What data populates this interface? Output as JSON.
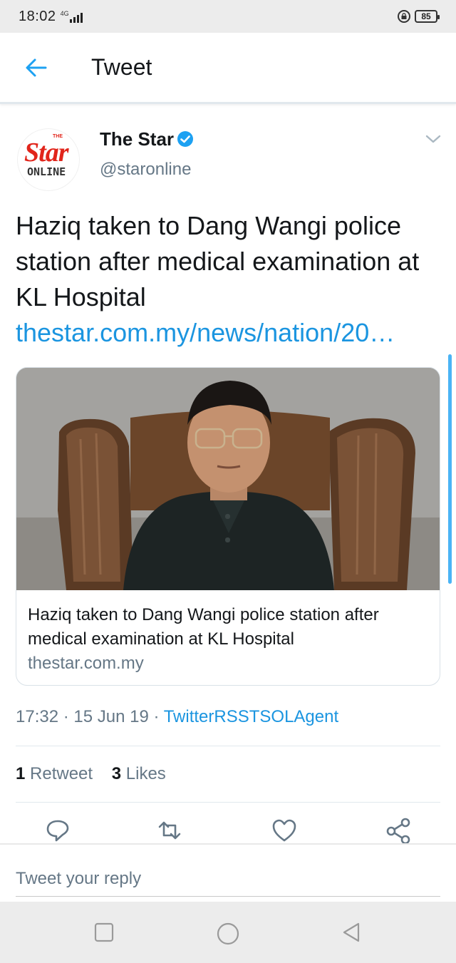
{
  "status_bar": {
    "time": "18:02",
    "network": "4G",
    "battery": "85"
  },
  "header": {
    "title": "Tweet"
  },
  "author": {
    "name": "The Star",
    "handle": "@staronline",
    "avatar_logo_top": "THE",
    "avatar_logo_main": "Star",
    "avatar_logo_sub": "ONLINE"
  },
  "tweet": {
    "text": "Haziq taken to Dang Wangi police station after medical examination at KL Hospital",
    "link": "thestar.com.my/news/nation/20…"
  },
  "card": {
    "title": "Haziq taken to Dang Wangi police station after medical examination at KL Hospital",
    "domain": "thestar.com.my"
  },
  "meta": {
    "time": "17:32",
    "date": "15 Jun 19",
    "separator": " · ",
    "source": "TwitterRSSTSOLAgent"
  },
  "stats": {
    "retweets_count": "1",
    "retweets_label": "Retweet",
    "likes_count": "3",
    "likes_label": "Likes"
  },
  "reply": {
    "placeholder": "Tweet your reply"
  },
  "colors": {
    "accent": "#1da1f2",
    "link": "#1b95e0",
    "muted": "#657786",
    "brand_red": "#e1251b"
  },
  "icons": {
    "back": "arrow-left-icon",
    "verified": "verified-badge-icon",
    "menu": "chevron-down-icon",
    "reply": "reply-icon",
    "retweet": "retweet-icon",
    "like": "heart-icon",
    "share": "share-icon",
    "nav_recent": "square-icon",
    "nav_home": "circle-icon",
    "nav_back": "triangle-back-icon"
  }
}
